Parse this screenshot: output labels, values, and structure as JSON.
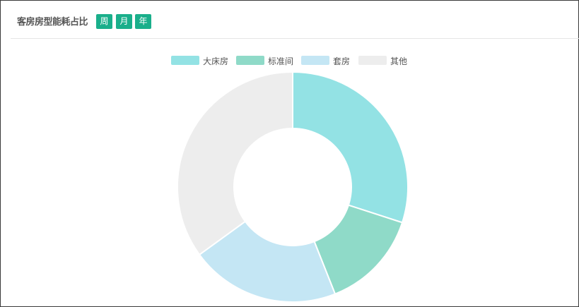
{
  "header": {
    "title": "客房房型能耗占比",
    "periods": [
      "周",
      "月",
      "年"
    ]
  },
  "chart_data": {
    "type": "pie",
    "variant": "donut",
    "title": "客房房型能耗占比",
    "legend_position": "top-center",
    "categories": [
      "大床房",
      "标准间",
      "套房",
      "其他"
    ],
    "values": [
      30,
      14,
      21,
      35
    ],
    "colors": [
      "#93e2e4",
      "#8fdac8",
      "#c4e6f4",
      "#ededed"
    ]
  }
}
